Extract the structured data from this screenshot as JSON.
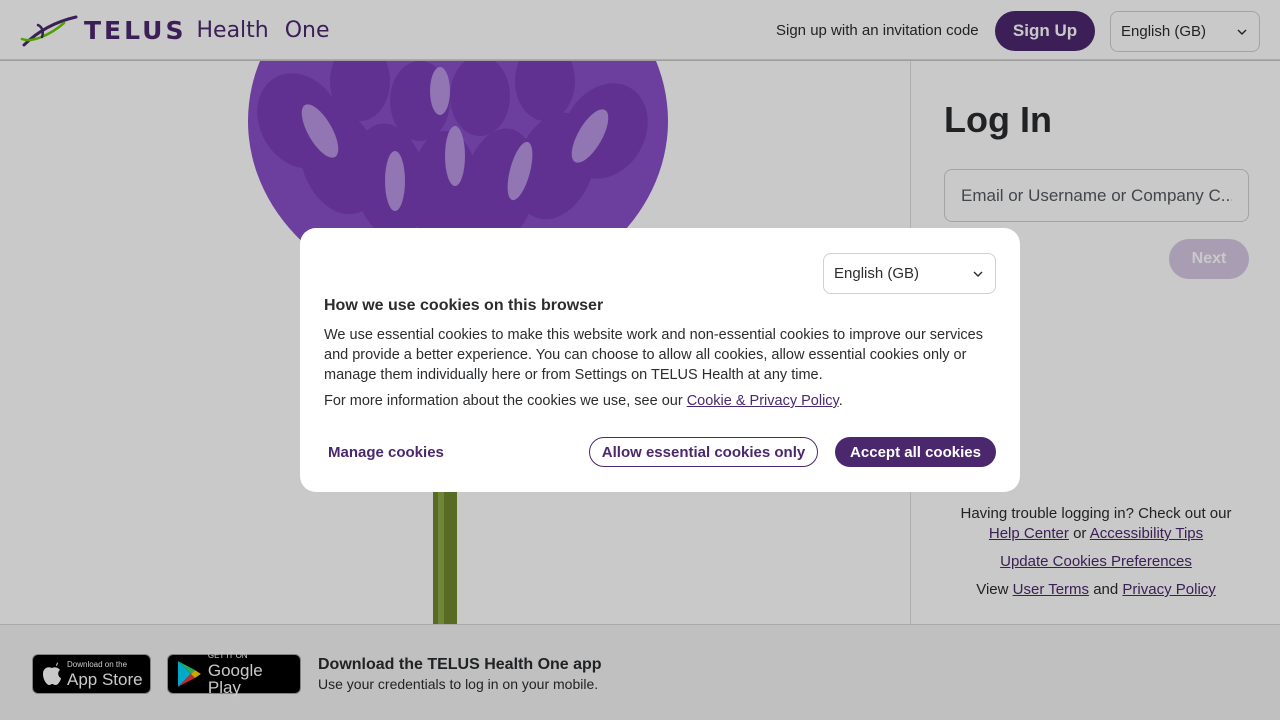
{
  "header": {
    "logo_brand": "TELUS",
    "logo_product": "Health",
    "logo_suffix": "One",
    "invite_link": "Sign up with an invitation code",
    "signup_label": "Sign Up",
    "language": "English (GB)"
  },
  "login": {
    "title": "Log In",
    "input_placeholder": "Email or Username or Company C...",
    "next_label": "Next",
    "help_text": "Having trouble logging in? Check out our",
    "help_center": "Help Center",
    "or": "or",
    "accessibility_tips": "Accessibility Tips",
    "update_cookies": "Update Cookies Preferences",
    "view": "View",
    "user_terms": "User Terms",
    "and": "and",
    "privacy_policy": "Privacy Policy"
  },
  "footer": {
    "app_store_small": "Download on the",
    "app_store_big": "App Store",
    "google_play_small": "GET IT ON",
    "google_play_big": "Google Play",
    "download_title": "Download the TELUS Health One app",
    "download_subtitle": "Use your credentials to log in on your mobile."
  },
  "cookie_dialog": {
    "language": "English (GB)",
    "title": "How we use cookies on this browser",
    "body": "We use essential cookies to make this website work and non-essential cookies to improve our services and provide a better experience. You can choose to allow all cookies, allow essential cookies only or manage them individually here or from Settings on TELUS Health at any time.",
    "more_info_prefix": "For more information about the cookies we use, see our",
    "policy_link": "Cookie & Privacy Policy",
    "more_info_suffix": ".",
    "manage_label": "Manage cookies",
    "essential_label": "Allow essential cookies only",
    "accept_label": "Accept all cookies"
  },
  "colors": {
    "brand_purple": "#4b286d",
    "brand_green": "#66cc00",
    "next_disabled": "#d7c8e4"
  },
  "icons": {
    "chevron": "chevron-down-icon",
    "apple": "apple-icon",
    "google_play": "google-play-icon",
    "logo_mark": "telus-swoosh-logo"
  }
}
